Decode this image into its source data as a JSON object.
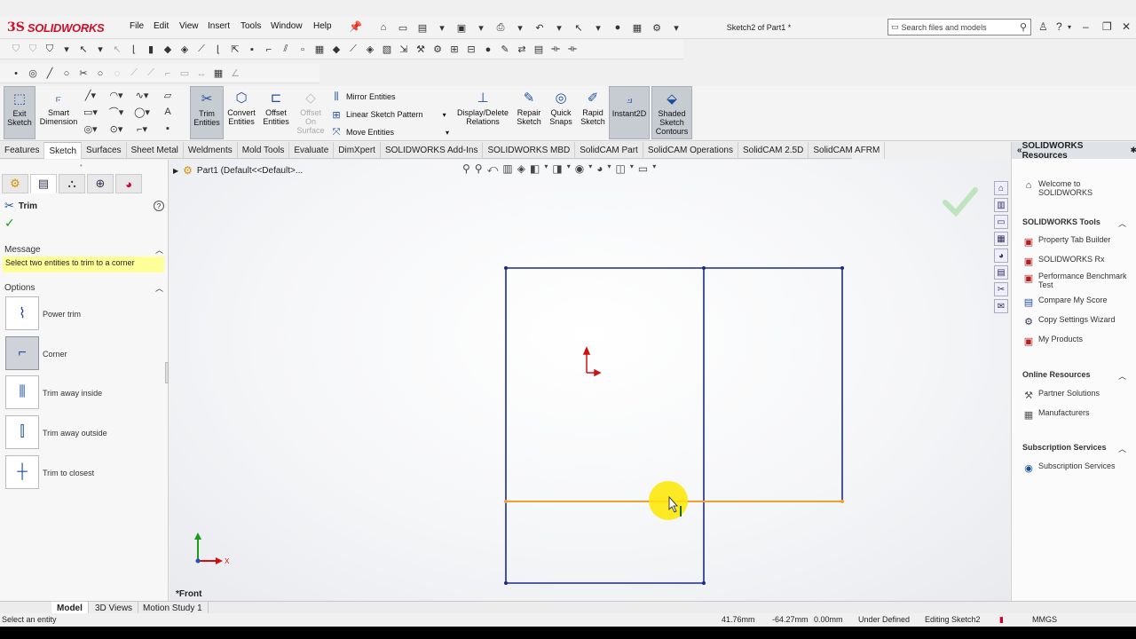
{
  "app": {
    "logo_ds": "3S",
    "logo_text": "SOLIDWORKS",
    "document_title": "Sketch2 of Part1 *",
    "search_placeholder": "Search files and models",
    "menu": [
      "File",
      "Edit",
      "View",
      "Insert",
      "Tools",
      "Window",
      "Help"
    ]
  },
  "command_manager": {
    "exit_sketch": "Exit Sketch",
    "smart_dimension": "Smart Dimension",
    "trim_entities": "Trim Entities",
    "convert_entities": "Convert Entities",
    "offset_entities": "Offset Entities",
    "offset_on_surface": "Offset On Surface",
    "mirror_entities": "Mirror Entities",
    "linear_sketch_pattern": "Linear Sketch Pattern",
    "move_entities": "Move Entities",
    "display_delete_relations": "Display/Delete Relations",
    "repair_sketch": "Repair Sketch",
    "quick_snaps": "Quick Snaps",
    "rapid_sketch": "Rapid Sketch",
    "instant2d": "Instant2D",
    "shaded_sketch_contours": "Shaded Sketch Contours"
  },
  "tabs": [
    "Features",
    "Sketch",
    "Surfaces",
    "Sheet Metal",
    "Weldments",
    "Mold Tools",
    "Evaluate",
    "DimXpert",
    "SOLIDWORKS Add-Ins",
    "SOLIDWORKS MBD",
    "SolidCAM Part",
    "SolidCAM Operations",
    "SolidCAM 2.5D",
    "SolidCAM AFRM"
  ],
  "active_tab_index": 1,
  "property_manager": {
    "title": "Trim",
    "help": "?",
    "ok": "✓",
    "message_header": "Message",
    "message_text": "Select two entities to trim to a corner",
    "options_header": "Options",
    "options": [
      {
        "label": "Power trim",
        "icon": "power-trim-icon",
        "active": false
      },
      {
        "label": "Corner",
        "icon": "corner-trim-icon",
        "active": true
      },
      {
        "label": "Trim away inside",
        "icon": "trim-inside-icon",
        "active": false
      },
      {
        "label": "Trim away outside",
        "icon": "trim-outside-icon",
        "active": false
      },
      {
        "label": "Trim to closest",
        "icon": "trim-closest-icon",
        "active": false
      }
    ]
  },
  "graphics": {
    "tree_item": "Part1  (Default<<Default>...",
    "view_label": "*Front",
    "axis_x": "X",
    "colors": {
      "sketch_line": "#1a2a8a",
      "selected_line": "#f0a030",
      "cursor_highlight": "#ffe600",
      "origin": "#d01010"
    }
  },
  "task_pane": {
    "header": "SOLIDWORKS Resources",
    "welcome": "Welcome to SOLIDWORKS",
    "tools_header": "SOLIDWORKS Tools",
    "tools": [
      "Property Tab Builder",
      "SOLIDWORKS Rx",
      "Performance Benchmark Test",
      "Compare My Score",
      "Copy Settings Wizard",
      "My Products"
    ],
    "online_header": "Online Resources",
    "online": [
      "Partner Solutions",
      "Manufacturers"
    ],
    "subscription_header": "Subscription Services",
    "subscription": [
      "Subscription Services"
    ]
  },
  "bottom_tabs": [
    "Model",
    "3D Views",
    "Motion Study 1"
  ],
  "status": {
    "left": "Select an entity",
    "x": "41.76mm",
    "y": "-64.27mm",
    "z": "0.00mm",
    "state": "Under Defined",
    "editing": "Editing Sketch2",
    "units": "MMGS"
  }
}
